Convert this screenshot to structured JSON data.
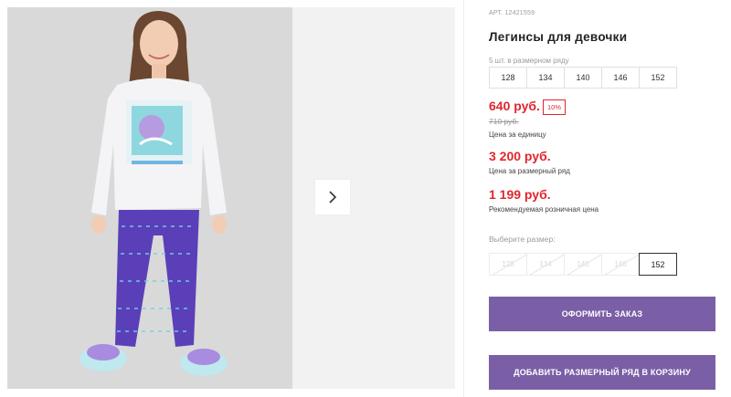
{
  "gallery": {
    "next_icon": "chevron-right-icon",
    "photo_colors": {
      "background": "#d8d8d8",
      "sweatshirt": "#f4f4f6",
      "leggings": "#5b3fb8",
      "print": "#7fd6e0"
    }
  },
  "product": {
    "article": "АРТ. 12421559",
    "title": "Легинсы для девочки",
    "row_label": "5 шт. в размерном ряду",
    "row_sizes": [
      "128",
      "134",
      "140",
      "146",
      "152"
    ],
    "price": "640 руб.",
    "discount": "10%",
    "old_price": "710 руб.",
    "per_unit_label": "Цена за единицу",
    "row_price": "3 200 руб.",
    "row_price_label": "Цена за размерный ряд",
    "rrp_price": "1 199 руб.",
    "rrp_label": "Рекомендуемая розничная цена",
    "choose_label": "Выберите размер:",
    "choose_sizes": [
      "128",
      "134",
      "140",
      "146",
      "152"
    ],
    "selected_size": "152"
  },
  "actions": {
    "order_label": "ОФОРМИТЬ ЗАКАЗ",
    "cart_label": "ДОБАВИТЬ РАЗМЕРНЫЙ РЯД В КОРЗИНУ"
  },
  "colors": {
    "accent": "#7b5fa6",
    "price": "#e0262e"
  }
}
